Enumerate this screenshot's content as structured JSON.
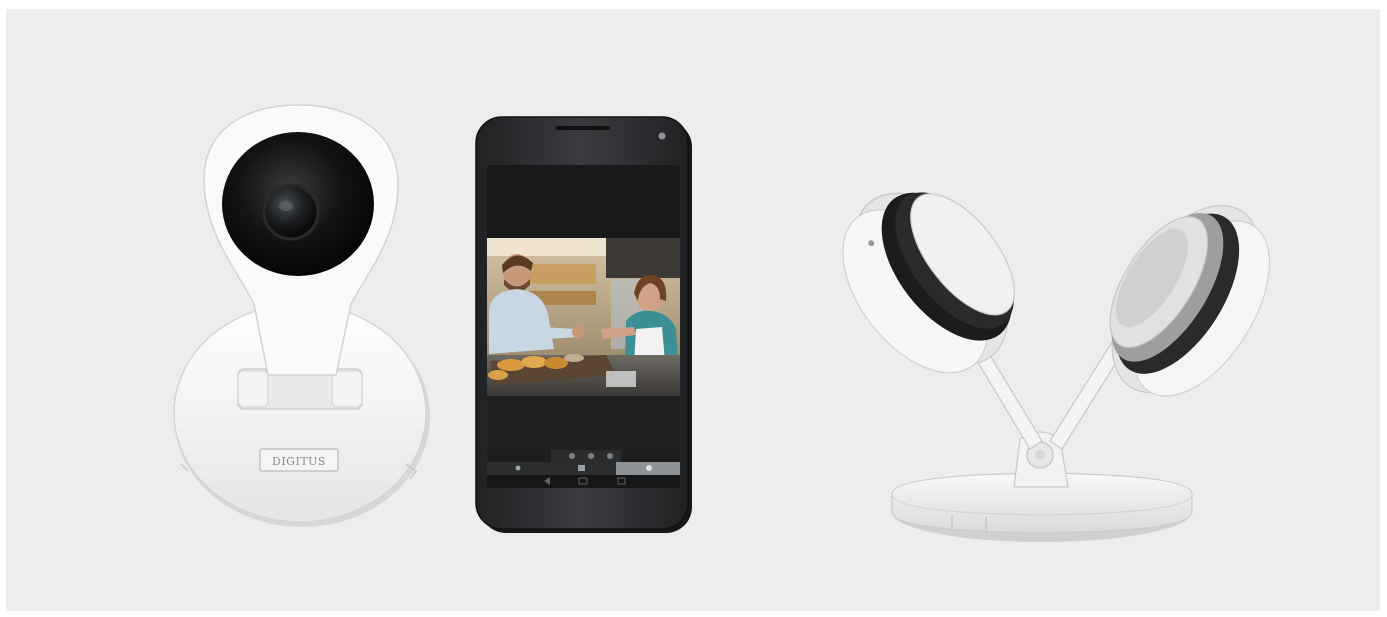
{
  "scene": {
    "background_color": "#eceeee",
    "camera_front": {
      "brand_text": "DIGITUS",
      "body_color": "#f7f7f7",
      "lens_color": "#151515"
    },
    "smartphone": {
      "frame_color": "#2d2f31",
      "screen_color": "#1a1c1d",
      "icon_names": [
        "play-icon",
        "record-icon",
        "snapshot-icon",
        "back-icon",
        "home-icon",
        "recent-apps-icon"
      ]
    },
    "camera_pair_angled": {
      "body_color": "#f4f4f4",
      "lens_ring_color": "#1c1c1c"
    }
  }
}
